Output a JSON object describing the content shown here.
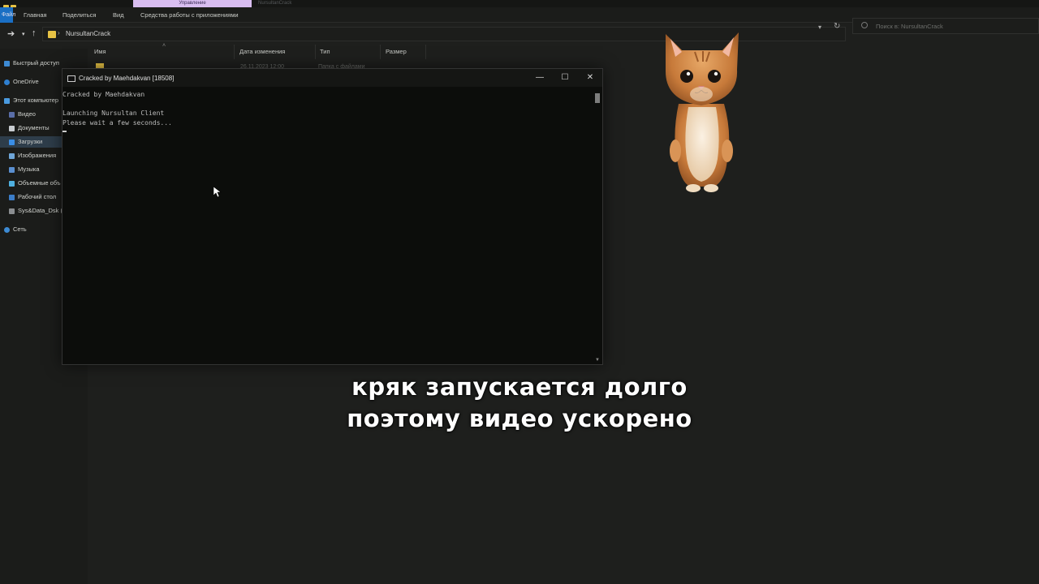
{
  "explorer": {
    "tab_label": "Управление",
    "tab_path": "NursultanCrack",
    "ribbon": {
      "file_tab": "Файл",
      "tabs": [
        "Главная",
        "Поделиться",
        "Вид",
        "Средства работы с приложениями"
      ]
    },
    "address": "NursultanCrack",
    "search_placeholder": "Поиск в: NursultanCrack",
    "nav_items": [
      "Быстрый доступ",
      "OneDrive",
      "Этот компьютер",
      "Видео",
      "Документы",
      "Загрузки",
      "Изображения",
      "Музыка",
      "Объемные объ",
      "Рабочий стол",
      "Sys&Data_Dsk (",
      "Сеть"
    ],
    "columns": [
      "Имя",
      "Дата изменения",
      "Тип",
      "Размер"
    ],
    "row_peek": [
      "26.11.2023 12:00",
      "Папка с файлами"
    ]
  },
  "console": {
    "title": "Cracked by Maehdakvan [18508]",
    "lines": [
      "Cracked by Maehdakvan",
      "",
      "Launching Nursultan Client",
      "Please wait a few seconds..."
    ],
    "controls": {
      "minimize": "—",
      "maximize": "☐",
      "close": "✕"
    }
  },
  "caption": {
    "line1": "кряк запускается долго",
    "line2": "поэтому видео ускорено"
  },
  "colors": {
    "accent": "#1a6fc4",
    "tab_highlight": "#d8bdf0",
    "folder": "#e6c244"
  }
}
